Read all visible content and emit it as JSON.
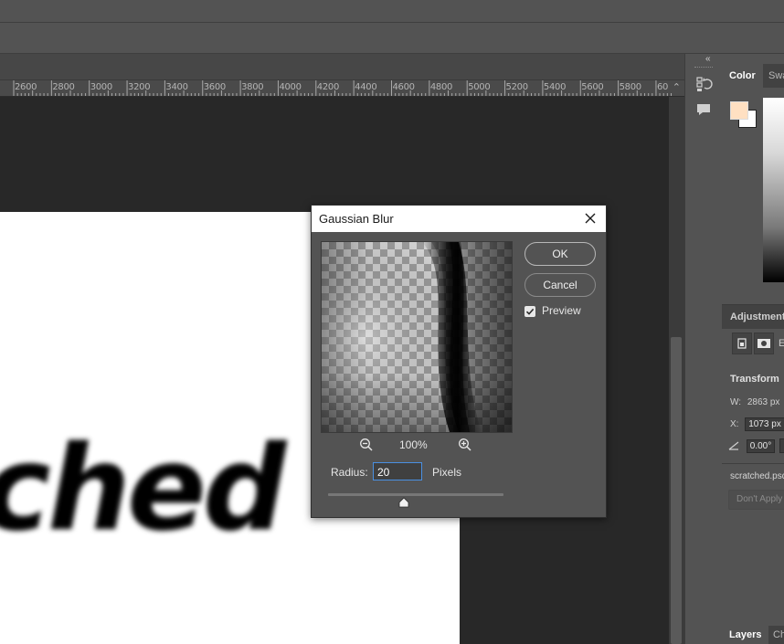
{
  "ruler": {
    "labels": [
      "2600",
      "2800",
      "3000",
      "3200",
      "3400",
      "3600",
      "3800",
      "4000",
      "4200",
      "4400",
      "4600",
      "4800",
      "5000",
      "5200",
      "5400",
      "5600",
      "5800",
      "60"
    ]
  },
  "document": {
    "visible_text": "ched"
  },
  "right_panel": {
    "color_tab": "Color",
    "swatches_tab": "Swa",
    "foreground_color": "#ffe0c2",
    "background_color": "#ffffff",
    "adjustments_title": "Adjustments",
    "adjustments_extra": "E",
    "transform_title": "Transform",
    "w_label": "W:",
    "w_value": "2863 px",
    "x_label": "X:",
    "x_value": "1073 px",
    "angle_value": "0.00°",
    "filename": "scratched.psd",
    "dont_apply": "Don't Apply",
    "layers_tab": "Layers",
    "channels_tab": "Ch"
  },
  "dialog": {
    "title": "Gaussian Blur",
    "ok_label": "OK",
    "cancel_label": "Cancel",
    "preview_label": "Preview",
    "preview_checked": true,
    "zoom_level": "100%",
    "radius_label": "Radius:",
    "radius_value": "20",
    "units_label": "Pixels",
    "slider_fraction": 0.43
  },
  "colors": {
    "accent_focus": "#4a90e2",
    "panel_bg": "#535353",
    "canvas_bg": "#282828"
  }
}
